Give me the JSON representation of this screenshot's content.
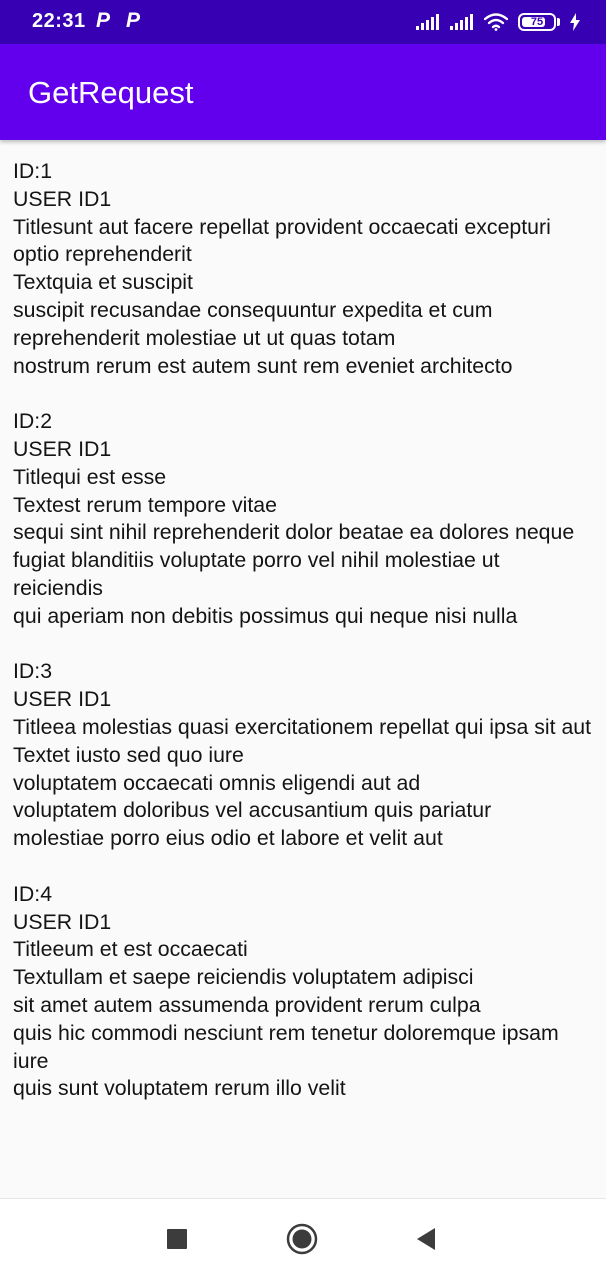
{
  "status_bar": {
    "time": "22:31",
    "app_icons": [
      "P",
      "P"
    ],
    "battery_level": 75,
    "battery_label": "75",
    "icons": [
      "signal-icon",
      "signal-icon",
      "wifi-icon",
      "battery-icon",
      "charging-icon"
    ]
  },
  "app_bar": {
    "title": "GetRequest"
  },
  "posts": [
    {
      "id": "ID:1",
      "user": "USER ID1",
      "title": "Titlesunt aut facere repellat provident occaecati excepturi optio reprehenderit",
      "text_lines": [
        "Textquia et suscipit",
        "suscipit recusandae consequuntur expedita et cum reprehenderit molestiae ut ut quas totam",
        "nostrum rerum est autem sunt rem eveniet architecto"
      ]
    },
    {
      "id": "ID:2",
      "user": "USER ID1",
      "title": "Titlequi est esse",
      "text_lines": [
        "Textest rerum tempore vitae",
        "sequi sint nihil reprehenderit dolor beatae ea dolores neque",
        "fugiat blanditiis voluptate porro vel nihil molestiae ut reiciendis",
        "qui aperiam non debitis possimus qui neque nisi nulla"
      ]
    },
    {
      "id": "ID:3",
      "user": "USER ID1",
      "title": "Titleea molestias quasi exercitationem repellat qui ipsa sit aut",
      "text_lines": [
        "Textet iusto sed quo iure",
        "voluptatem occaecati omnis eligendi aut ad",
        "voluptatem doloribus vel accusantium quis pariatur",
        "molestiae porro eius odio et labore et velit aut"
      ]
    },
    {
      "id": "ID:4",
      "user": "USER ID1",
      "title": "Titleeum et est occaecati",
      "text_lines": [
        "Textullam et saepe reiciendis voluptatem adipisci",
        "sit amet autem assumenda provident rerum culpa",
        "quis hic commodi nesciunt rem tenetur doloremque ipsam iure",
        "quis sunt voluptatem rerum illo velit"
      ]
    }
  ],
  "nav_bar": {
    "buttons": [
      "recents-square-icon",
      "home-circle-icon",
      "back-triangle-icon"
    ]
  },
  "colors": {
    "status_bar": "#3700b3",
    "app_bar": "#6200ee",
    "background": "#fafafa",
    "text": "#141414",
    "nav_icon": "#3c3c3c"
  }
}
